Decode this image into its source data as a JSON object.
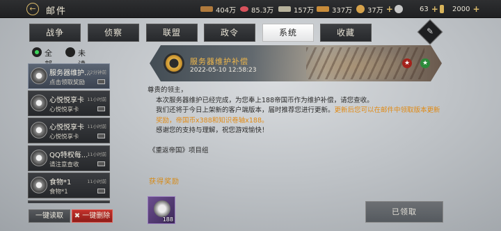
{
  "header": {
    "title": "邮件"
  },
  "resources": [
    {
      "value": "404万",
      "color": "#b07a3c"
    },
    {
      "value": "85.3万",
      "color": "#d8525c"
    },
    {
      "value": "157万",
      "color": "#b7b29c"
    },
    {
      "value": "337万",
      "color": "#c88c3a"
    },
    {
      "value": "37万",
      "color": "#d6a24b"
    },
    {
      "value": "63",
      "color": "#c7c7c7"
    },
    {
      "value": "2000",
      "color": "#d8b35a"
    }
  ],
  "tabs": [
    "战争",
    "侦察",
    "联盟",
    "政令",
    "系统",
    "收藏"
  ],
  "active_tab": "系统",
  "filter": {
    "all": "全部",
    "unread": "未读"
  },
  "mails": [
    {
      "title": "服务器维护...",
      "subtitle": "点击领取奖励",
      "time": "22分钟前",
      "selected": true
    },
    {
      "title": "心悦悦享卡",
      "subtitle": "心悦悦享卡",
      "time": "11小时前",
      "selected": false
    },
    {
      "title": "心悦悦享卡",
      "subtitle": "心悦悦享卡",
      "time": "11小时前",
      "selected": false
    },
    {
      "title": "QQ特权每...",
      "subtitle": "请注意查收",
      "time": "11小时前",
      "selected": false
    },
    {
      "title": "食物*1",
      "subtitle": "食物*1",
      "time": "11小时前",
      "selected": false
    }
  ],
  "footer": {
    "read_all": "一键读取",
    "delete_all": "一键删除"
  },
  "detail": {
    "title": "服务器维护补偿",
    "date": "2022-05-10 12:58:23",
    "greeting": "尊贵的领主，",
    "line1": "本次服务器维护已经完成，为您奉上188帝国币作为维护补偿，请您查收。",
    "line2_prefix": "我们还将于今日上架新的客户端版本，届时推荐您进行更新。",
    "line2_highlight": "更新后您可以在邮件中领取版本更新奖励，帝国币x388和知识卷轴x188。",
    "line3": "感谢您的支持与理解，祝您游戏愉快！",
    "signature": "《重返帝国》项目组",
    "rewards_label": "获得奖励",
    "reward_count": "188",
    "claimed_label": "已领取"
  },
  "colors": {
    "accent": "#e08a14",
    "delete": "#b8261f",
    "active_tab": "#ffffff"
  }
}
